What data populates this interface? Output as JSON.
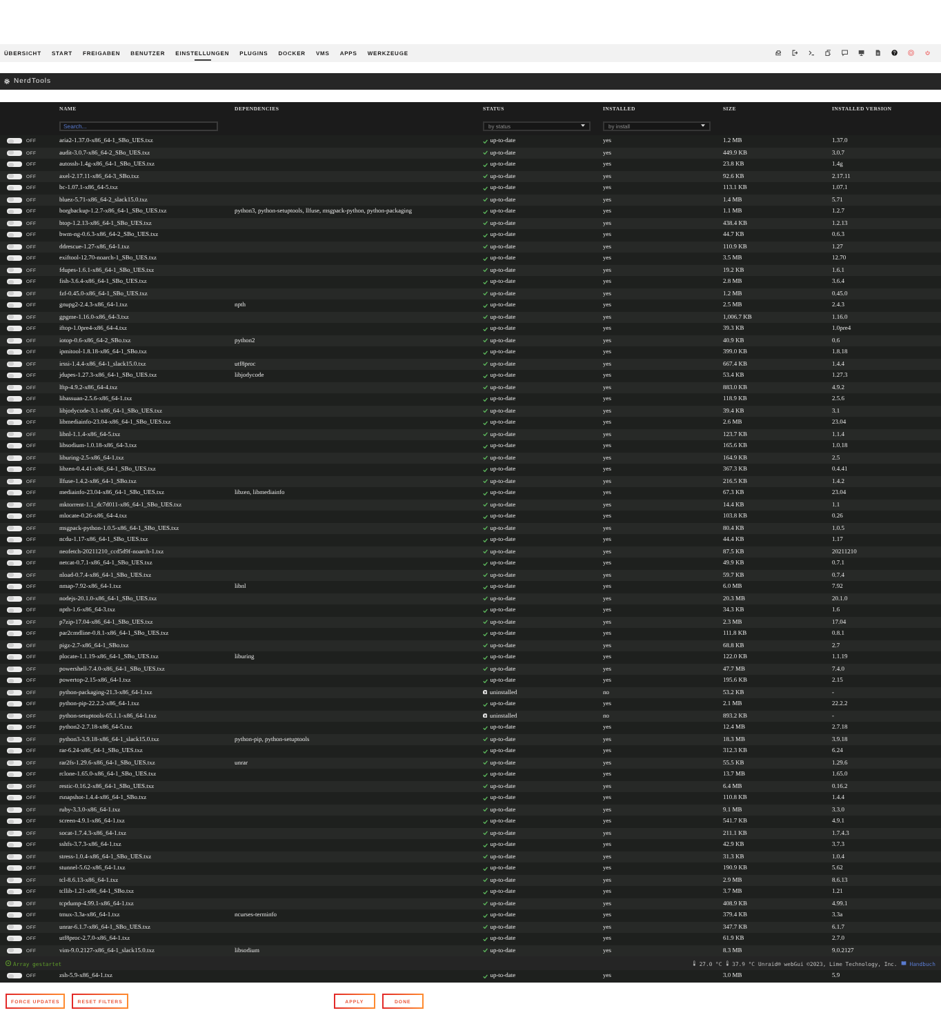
{
  "nav": {
    "tabs": [
      {
        "label": "ÜBERSICHT",
        "selected": false
      },
      {
        "label": "START",
        "selected": false
      },
      {
        "label": "FREIGABEN",
        "selected": false
      },
      {
        "label": "BENUTZER",
        "selected": false
      },
      {
        "label": "EINSTELLUNGEN",
        "selected": true
      },
      {
        "label": "PLUGINS",
        "selected": false
      },
      {
        "label": "DOCKER",
        "selected": false
      },
      {
        "label": "VMS",
        "selected": false
      },
      {
        "label": "APPS",
        "selected": false
      },
      {
        "label": "WERKZEUGE",
        "selected": false
      }
    ]
  },
  "panel": {
    "title": "NerdTools"
  },
  "table": {
    "columns": [
      "NAME",
      "DEPENDENCIES",
      "STATUS",
      "INSTALLED",
      "SIZE",
      "INSTALLED VERSION"
    ],
    "filters": {
      "search": {
        "placeholder": "Search..."
      },
      "status": {
        "value": "by status"
      },
      "installed": {
        "value": "by install"
      }
    },
    "rows": [
      {
        "on": false,
        "switch": "OFF",
        "name": "aria2-1.37.0-x86_64-1_SBo_UES.txz",
        "kind": "current",
        "status": "up-to-date",
        "installed": "yes",
        "size": "1.2 MB",
        "version": "1.37.0"
      },
      {
        "on": false,
        "switch": "OFF",
        "name": "audit-3.0.7-x86_64-2_SBo_UES.txz",
        "kind": "current",
        "status": "up-to-date",
        "installed": "yes",
        "size": "449.9 KB",
        "version": "3.0.7"
      },
      {
        "on": false,
        "switch": "OFF",
        "name": "autossh-1.4g-x86_64-1_SBo_UES.txz",
        "kind": "current",
        "status": "up-to-date",
        "installed": "yes",
        "size": "23.8 KB",
        "version": "1.4g"
      },
      {
        "on": false,
        "switch": "OFF",
        "name": "axel-2.17.11-x86_64-3_SBo.txz",
        "kind": "current",
        "status": "up-to-date",
        "installed": "yes",
        "size": "92.6 KB",
        "version": "2.17.11"
      },
      {
        "on": false,
        "switch": "OFF",
        "name": "bc-1.07.1-x86_64-5.txz",
        "kind": "current",
        "status": "up-to-date",
        "installed": "yes",
        "size": "113.1 KB",
        "version": "1.07.1"
      },
      {
        "on": false,
        "switch": "OFF",
        "name": "bluez-5.71-x86_64-2_slack15.0.txz",
        "kind": "current",
        "status": "up-to-date",
        "installed": "yes",
        "size": "1.4 MB",
        "version": "5.71"
      },
      {
        "on": false,
        "switch": "OFF",
        "name": "borgbackup-1.2.7-x86_64-1_SBo_UES.txz",
        "dependencies": "python3, python-setuptools, llfuse, msgpack-python, python-packaging",
        "kind": "current",
        "status": "up-to-date",
        "installed": "yes",
        "size": "1.1 MB",
        "version": "1.2.7"
      },
      {
        "on": false,
        "switch": "OFF",
        "name": "btop-1.2.13-x86_64-1_SBo_UES.txz",
        "kind": "current",
        "status": "up-to-date",
        "installed": "yes",
        "size": "438.4 KB",
        "version": "1.2.13"
      },
      {
        "on": false,
        "switch": "OFF",
        "name": "bwm-ng-0.6.3-x86_64-2_SBo_UES.txz",
        "kind": "current",
        "status": "up-to-date",
        "installed": "yes",
        "size": "44.7 KB",
        "version": "0.6.3"
      },
      {
        "on": false,
        "switch": "OFF",
        "name": "ddrescue-1.27-x86_64-1.txz",
        "kind": "current",
        "status": "up-to-date",
        "installed": "yes",
        "size": "110.9 KB",
        "version": "1.27"
      },
      {
        "on": false,
        "switch": "OFF",
        "name": "exiftool-12.70-noarch-1_SBo_UES.txz",
        "kind": "current",
        "status": "up-to-date",
        "installed": "yes",
        "size": "3.5 MB",
        "version": "12.70"
      },
      {
        "on": false,
        "switch": "OFF",
        "name": "fdupes-1.6.1-x86_64-1_SBo_UES.txz",
        "kind": "current",
        "status": "up-to-date",
        "installed": "yes",
        "size": "19.2 KB",
        "version": "1.6.1"
      },
      {
        "on": false,
        "switch": "OFF",
        "name": "fish-3.6.4-x86_64-1_SBo_UES.txz",
        "kind": "current",
        "status": "up-to-date",
        "installed": "yes",
        "size": "2.8 MB",
        "version": "3.6.4"
      },
      {
        "on": false,
        "switch": "OFF",
        "name": "fzf-0.45.0-x86_64-1_SBo_UES.txz",
        "kind": "current",
        "status": "up-to-date",
        "installed": "yes",
        "size": "1.2 MB",
        "version": "0.45.0"
      },
      {
        "on": false,
        "switch": "OFF",
        "name": "gnupg2-2.4.3-x86_64-1.txz",
        "dependencies": "npth",
        "kind": "current",
        "status": "up-to-date",
        "installed": "yes",
        "size": "2.5 MB",
        "version": "2.4.3"
      },
      {
        "on": false,
        "switch": "OFF",
        "name": "gpgme-1.16.0-x86_64-3.txz",
        "kind": "current",
        "status": "up-to-date",
        "installed": "yes",
        "size": "1,006.7 KB",
        "version": "1.16.0"
      },
      {
        "on": false,
        "switch": "OFF",
        "name": "iftop-1.0pre4-x86_64-4.txz",
        "kind": "current",
        "status": "up-to-date",
        "installed": "yes",
        "size": "39.3 KB",
        "version": "1.0pre4"
      },
      {
        "on": false,
        "switch": "OFF",
        "name": "iotop-0.6-x86_64-2_SBo.txz",
        "dependencies": "python2",
        "kind": "current",
        "status": "up-to-date",
        "installed": "yes",
        "size": "40.9 KB",
        "version": "0.6"
      },
      {
        "on": false,
        "switch": "OFF",
        "name": "ipmitool-1.8.18-x86_64-1_SBo.txz",
        "kind": "current",
        "status": "up-to-date",
        "installed": "yes",
        "size": "399.0 KB",
        "version": "1.8.18"
      },
      {
        "on": false,
        "switch": "OFF",
        "name": "irssi-1.4.4-x86_64-1_slack15.0.txz",
        "dependencies": "utf8proc",
        "kind": "current",
        "status": "up-to-date",
        "installed": "yes",
        "size": "667.4 KB",
        "version": "1.4.4"
      },
      {
        "on": false,
        "switch": "OFF",
        "name": "jdupes-1.27.3-x86_64-1_SBo_UES.txz",
        "dependencies": "libjodycode",
        "kind": "current",
        "status": "up-to-date",
        "installed": "yes",
        "size": "53.4 KB",
        "version": "1.27.3"
      },
      {
        "on": false,
        "switch": "OFF",
        "name": "lftp-4.9.2-x86_64-4.txz",
        "kind": "current",
        "status": "up-to-date",
        "installed": "yes",
        "size": "883.0 KB",
        "version": "4.9.2"
      },
      {
        "on": false,
        "switch": "OFF",
        "name": "libassuan-2.5.6-x86_64-1.txz",
        "kind": "current",
        "status": "up-to-date",
        "installed": "yes",
        "size": "118.9 KB",
        "version": "2.5.6"
      },
      {
        "on": false,
        "switch": "OFF",
        "name": "libjodycode-3.1-x86_64-1_SBo_UES.txz",
        "kind": "current",
        "status": "up-to-date",
        "installed": "yes",
        "size": "39.4 KB",
        "version": "3.1"
      },
      {
        "on": false,
        "switch": "OFF",
        "name": "libmediainfo-23.04-x86_64-1_SBo_UES.txz",
        "kind": "current",
        "status": "up-to-date",
        "installed": "yes",
        "size": "2.6 MB",
        "version": "23.04"
      },
      {
        "on": false,
        "switch": "OFF",
        "name": "libnl-1.1.4-x86_64-5.txz",
        "kind": "current",
        "status": "up-to-date",
        "installed": "yes",
        "size": "123.7 KB",
        "version": "1.1.4"
      },
      {
        "on": false,
        "switch": "OFF",
        "name": "libsodium-1.0.18-x86_64-3.txz",
        "kind": "current",
        "status": "up-to-date",
        "installed": "yes",
        "size": "165.6 KB",
        "version": "1.0.18"
      },
      {
        "on": false,
        "switch": "OFF",
        "name": "liburing-2.5-x86_64-1.txz",
        "kind": "current",
        "status": "up-to-date",
        "installed": "yes",
        "size": "164.9 KB",
        "version": "2.5"
      },
      {
        "on": false,
        "switch": "OFF",
        "name": "libzen-0.4.41-x86_64-1_SBo_UES.txz",
        "kind": "current",
        "status": "up-to-date",
        "installed": "yes",
        "size": "367.3 KB",
        "version": "0.4.41"
      },
      {
        "on": false,
        "switch": "OFF",
        "name": "llfuse-1.4.2-x86_64-1_SBo.txz",
        "kind": "current",
        "status": "up-to-date",
        "installed": "yes",
        "size": "216.5 KB",
        "version": "1.4.2"
      },
      {
        "on": false,
        "switch": "OFF",
        "name": "mediainfo-23.04-x86_64-1_SBo_UES.txz",
        "dependencies": "libzen, libmediainfo",
        "kind": "current",
        "status": "up-to-date",
        "installed": "yes",
        "size": "67.3 KB",
        "version": "23.04"
      },
      {
        "on": false,
        "switch": "OFF",
        "name": "mktorrent-1.1_dc7d011-x86_64-1_SBo_UES.txz",
        "kind": "current",
        "status": "up-to-date",
        "installed": "yes",
        "size": "14.4 KB",
        "version": "1.1"
      },
      {
        "on": false,
        "switch": "OFF",
        "name": "mlocate-0.26-x86_64-4.txz",
        "kind": "current",
        "status": "up-to-date",
        "installed": "yes",
        "size": "103.8 KB",
        "version": "0.26"
      },
      {
        "on": false,
        "switch": "OFF",
        "name": "msgpack-python-1.0.5-x86_64-1_SBo_UES.txz",
        "kind": "current",
        "status": "up-to-date",
        "installed": "yes",
        "size": "80.4 KB",
        "version": "1.0.5"
      },
      {
        "on": false,
        "switch": "OFF",
        "name": "ncdu-1.17-x86_64-1_SBo_UES.txz",
        "kind": "current",
        "status": "up-to-date",
        "installed": "yes",
        "size": "44.4 KB",
        "version": "1.17"
      },
      {
        "on": false,
        "switch": "OFF",
        "name": "neofetch-20211210_ccd5d9f-noarch-1.txz",
        "kind": "current",
        "status": "up-to-date",
        "installed": "yes",
        "size": "87.5 KB",
        "version": "20211210"
      },
      {
        "on": false,
        "switch": "OFF",
        "name": "netcat-0.7.1-x86_64-1_SBo_UES.txz",
        "kind": "current",
        "status": "up-to-date",
        "installed": "yes",
        "size": "49.9 KB",
        "version": "0.7.1"
      },
      {
        "on": false,
        "switch": "OFF",
        "name": "nload-0.7.4-x86_64-1_SBo_UES.txz",
        "kind": "current",
        "status": "up-to-date",
        "installed": "yes",
        "size": "59.7 KB",
        "version": "0.7.4"
      },
      {
        "on": false,
        "switch": "OFF",
        "name": "nmap-7.92-x86_64-1.txz",
        "dependencies": "libnl",
        "kind": "current",
        "status": "up-to-date",
        "installed": "yes",
        "size": "6.0 MB",
        "version": "7.92"
      },
      {
        "on": false,
        "switch": "OFF",
        "name": "nodejs-20.1.0-x86_64-1_SBo_UES.txz",
        "kind": "current",
        "status": "up-to-date",
        "installed": "yes",
        "size": "20.3 MB",
        "version": "20.1.0"
      },
      {
        "on": false,
        "switch": "OFF",
        "name": "npth-1.6-x86_64-3.txz",
        "kind": "current",
        "status": "up-to-date",
        "installed": "yes",
        "size": "34.3 KB",
        "version": "1.6"
      },
      {
        "on": false,
        "switch": "OFF",
        "name": "p7zip-17.04-x86_64-1_SBo_UES.txz",
        "kind": "current",
        "status": "up-to-date",
        "installed": "yes",
        "size": "2.3 MB",
        "version": "17.04"
      },
      {
        "on": false,
        "switch": "OFF",
        "name": "par2cmdline-0.8.1-x86_64-1_SBo_UES.txz",
        "kind": "current",
        "status": "up-to-date",
        "installed": "yes",
        "size": "111.8 KB",
        "version": "0.8.1"
      },
      {
        "on": false,
        "switch": "OFF",
        "name": "pigz-2.7-x86_64-1_SBo.txz",
        "kind": "current",
        "status": "up-to-date",
        "installed": "yes",
        "size": "68.8 KB",
        "version": "2.7"
      },
      {
        "on": false,
        "switch": "OFF",
        "name": "plocate-1.1.19-x86_64-1_SBo_UES.txz",
        "dependencies": "liburing",
        "kind": "current",
        "status": "up-to-date",
        "installed": "yes",
        "size": "122.0 KB",
        "version": "1.1.19"
      },
      {
        "on": false,
        "switch": "OFF",
        "name": "powershell-7.4.0-x86_64-1_SBo_UES.txz",
        "kind": "current",
        "status": "up-to-date",
        "installed": "yes",
        "size": "47.7 MB",
        "version": "7.4.0"
      },
      {
        "on": false,
        "switch": "OFF",
        "name": "powertop-2.15-x86_64-1.txz",
        "kind": "current",
        "status": "up-to-date",
        "installed": "yes",
        "size": "195.6 KB",
        "version": "2.15"
      },
      {
        "on": false,
        "switch": "OFF",
        "name": "python-packaging-21.3-x86_64-1.txz",
        "kind": "missing",
        "status": "uninstalled",
        "installed": "no",
        "size": "53.2 KB",
        "version": "-"
      },
      {
        "on": false,
        "switch": "OFF",
        "name": "python-pip-22.2.2-x86_64-1.txz",
        "kind": "current",
        "status": "up-to-date",
        "installed": "yes",
        "size": "2.1 MB",
        "version": "22.2.2"
      },
      {
        "on": false,
        "switch": "OFF",
        "name": "python-setuptools-65.1.1-x86_64-1.txz",
        "kind": "missing",
        "status": "uninstalled",
        "installed": "no",
        "size": "893.2 KB",
        "version": "-"
      },
      {
        "on": false,
        "switch": "OFF",
        "name": "python2-2.7.18-x86_64-5.txz",
        "kind": "current",
        "status": "up-to-date",
        "installed": "yes",
        "size": "12.4 MB",
        "version": "2.7.18"
      },
      {
        "on": false,
        "switch": "OFF",
        "name": "python3-3.9.18-x86_64-1_slack15.0.txz",
        "dependencies": "python-pip, python-setuptools",
        "kind": "current",
        "status": "up-to-date",
        "installed": "yes",
        "size": "18.3 MB",
        "version": "3.9.18"
      },
      {
        "on": false,
        "switch": "OFF",
        "name": "rar-6.24-x86_64-1_SBo_UES.txz",
        "kind": "current",
        "status": "up-to-date",
        "installed": "yes",
        "size": "312.3 KB",
        "version": "6.24"
      },
      {
        "on": false,
        "switch": "OFF",
        "name": "rar2fs-1.29.6-x86_64-1_SBo_UES.txz",
        "dependencies": "unrar",
        "kind": "current",
        "status": "up-to-date",
        "installed": "yes",
        "size": "55.5 KB",
        "version": "1.29.6"
      },
      {
        "on": false,
        "switch": "OFF",
        "name": "rclone-1.65.0-x86_64-1_SBo_UES.txz",
        "kind": "current",
        "status": "up-to-date",
        "installed": "yes",
        "size": "13.7 MB",
        "version": "1.65.0"
      },
      {
        "on": false,
        "switch": "OFF",
        "name": "restic-0.16.2-x86_64-1_SBo_UES.txz",
        "kind": "current",
        "status": "up-to-date",
        "installed": "yes",
        "size": "6.4 MB",
        "version": "0.16.2"
      },
      {
        "on": false,
        "switch": "OFF",
        "name": "rsnapshot-1.4.4-x86_64-1_SBo.txz",
        "kind": "current",
        "status": "up-to-date",
        "installed": "yes",
        "size": "110.8 KB",
        "version": "1.4.4"
      },
      {
        "on": false,
        "switch": "OFF",
        "name": "ruby-3.3.0-x86_64-1.txz",
        "kind": "current",
        "status": "up-to-date",
        "installed": "yes",
        "size": "9.1 MB",
        "version": "3.3.0"
      },
      {
        "on": false,
        "switch": "OFF",
        "name": "screen-4.9.1-x86_64-1.txz",
        "kind": "current",
        "status": "up-to-date",
        "installed": "yes",
        "size": "541.7 KB",
        "version": "4.9.1"
      },
      {
        "on": false,
        "switch": "OFF",
        "name": "socat-1.7.4.3-x86_64-1.txz",
        "kind": "current",
        "status": "up-to-date",
        "installed": "yes",
        "size": "211.1 KB",
        "version": "1.7.4.3"
      },
      {
        "on": false,
        "switch": "OFF",
        "name": "sshfs-3.7.3-x86_64-1.txz",
        "kind": "current",
        "status": "up-to-date",
        "installed": "yes",
        "size": "42.9 KB",
        "version": "3.7.3"
      },
      {
        "on": false,
        "switch": "OFF",
        "name": "stress-1.0.4-x86_64-1_SBo_UES.txz",
        "kind": "current",
        "status": "up-to-date",
        "installed": "yes",
        "size": "31.3 KB",
        "version": "1.0.4"
      },
      {
        "on": false,
        "switch": "OFF",
        "name": "stunnel-5.62-x86_64-1.txz",
        "kind": "current",
        "status": "up-to-date",
        "installed": "yes",
        "size": "190.9 KB",
        "version": "5.62"
      },
      {
        "on": false,
        "switch": "OFF",
        "name": "tcl-8.6.13-x86_64-1.txz",
        "kind": "current",
        "status": "up-to-date",
        "installed": "yes",
        "size": "2.9 MB",
        "version": "8.6.13"
      },
      {
        "on": false,
        "switch": "OFF",
        "name": "tcllib-1.21-x86_64-1_SBo.txz",
        "kind": "current",
        "status": "up-to-date",
        "installed": "yes",
        "size": "3.7 MB",
        "version": "1.21"
      },
      {
        "on": false,
        "switch": "OFF",
        "name": "tcpdump-4.99.1-x86_64-1.txz",
        "kind": "current",
        "status": "up-to-date",
        "installed": "yes",
        "size": "408.9 KB",
        "version": "4.99.1"
      },
      {
        "on": false,
        "switch": "OFF",
        "name": "tmux-3.3a-x86_64-1.txz",
        "dependencies": "ncurses-terminfo",
        "kind": "current",
        "status": "up-to-date",
        "installed": "yes",
        "size": "379.4 KB",
        "version": "3.3a"
      },
      {
        "on": false,
        "switch": "OFF",
        "name": "unrar-6.1.7-x86_64-1_SBo_UES.txz",
        "kind": "current",
        "status": "up-to-date",
        "installed": "yes",
        "size": "347.7 KB",
        "version": "6.1.7"
      },
      {
        "on": false,
        "switch": "OFF",
        "name": "utf8proc-2.7.0-x86_64-1.txz",
        "kind": "current",
        "status": "up-to-date",
        "installed": "yes",
        "size": "61.9 KB",
        "version": "2.7.0"
      },
      {
        "on": false,
        "switch": "OFF",
        "name": "vim-9.0.2127-x86_64-1_slack15.0.txz",
        "dependencies": "libsodium",
        "kind": "current",
        "status": "up-to-date",
        "installed": "yes",
        "size": "8.3 MB",
        "version": "9.0.2127"
      }
    ]
  },
  "status_bar": {
    "array": {
      "kind": "started",
      "text": "Array gestartet"
    },
    "temperatures": [
      "27.0 °C",
      "37.9 °C"
    ],
    "copyright": "Unraid® webGui ©2023, Lime Technology, Inc.",
    "manual_link": "Handbuch"
  },
  "rows_below_status_bar": [
    {
      "on": false,
      "switch": "OFF",
      "name": "zsh-5.9-x86_64-1.txz",
      "kind": "current",
      "status": "up-to-date",
      "installed": "yes",
      "size": "3.0 MB",
      "version": "5.9"
    }
  ],
  "buttons": {
    "left": [
      {
        "label": "FORCE UPDATES"
      },
      {
        "label": "RESET FILTERS"
      }
    ],
    "center": [
      {
        "label": "APPLY"
      },
      {
        "label": "DONE"
      }
    ]
  }
}
